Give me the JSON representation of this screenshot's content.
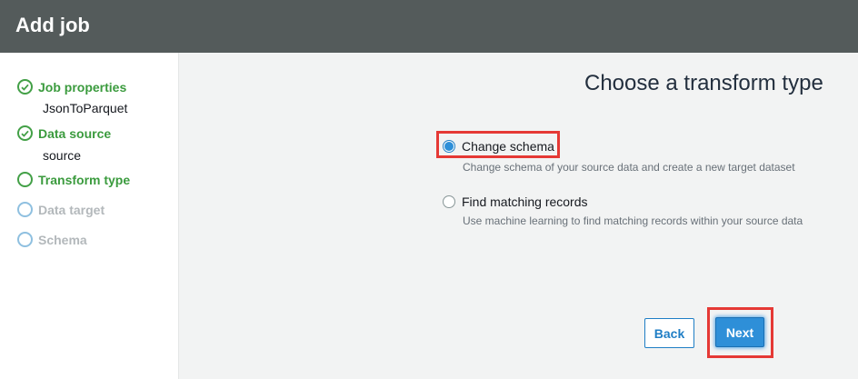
{
  "header": {
    "title": "Add job"
  },
  "sidebar": {
    "steps": [
      {
        "label": "Job properties",
        "status": "done",
        "sub": "JsonToParquet"
      },
      {
        "label": "Data source",
        "status": "done",
        "sub": "source"
      },
      {
        "label": "Transform type",
        "status": "current"
      },
      {
        "label": "Data target",
        "status": "pending"
      },
      {
        "label": "Schema",
        "status": "pending"
      }
    ]
  },
  "main": {
    "title": "Choose a transform type",
    "options": [
      {
        "label": "Change schema",
        "description": "Change schema of your source data and create a new target dataset",
        "selected": true
      },
      {
        "label": "Find matching records",
        "description": "Use machine learning to find matching records within your source data",
        "selected": false
      }
    ]
  },
  "footer": {
    "back_label": "Back",
    "next_label": "Next"
  },
  "colors": {
    "header_bg": "#545b5b",
    "done_green": "#3b9b3e",
    "primary_blue": "#2e8fd8",
    "highlight_red": "#e53935"
  }
}
